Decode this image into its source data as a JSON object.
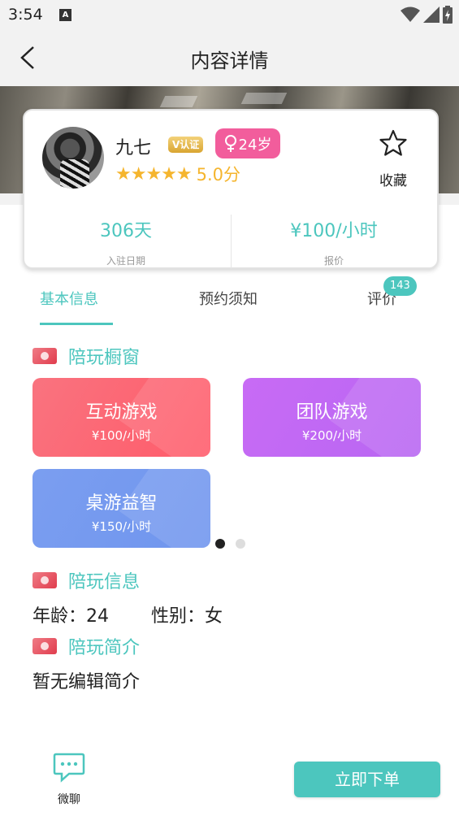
{
  "status_bar": {
    "time": "3:54",
    "notification_letter": "A"
  },
  "header": {
    "title": "内容详情"
  },
  "profile": {
    "nickname": "九七",
    "verified_label": "V认证",
    "age_label": "24岁",
    "stars": "★★★★★",
    "rating": "5.0分",
    "favorite_label": "收藏",
    "days_value": "306天",
    "days_label": "入驻日期",
    "price_value": "¥100/小时",
    "price_label": "报价"
  },
  "tabs": [
    {
      "label": "基本信息",
      "active": true
    },
    {
      "label": "预约须知",
      "active": false
    },
    {
      "label": "评价",
      "active": false,
      "badge": "143"
    }
  ],
  "sections": {
    "showcase_title": "陪玩橱窗",
    "info_title": "陪玩信息",
    "intro_title": "陪玩简介"
  },
  "services": [
    {
      "name": "互动游戏",
      "price": "¥100/小时"
    },
    {
      "name": "团队游戏",
      "price": "¥200/小时"
    },
    {
      "name": "桌游益智",
      "price": "¥150/小时"
    }
  ],
  "carousel": {
    "pages": 2,
    "current": 1
  },
  "info": {
    "age_text": "年龄：24",
    "gender_text": "性别：女"
  },
  "intro": {
    "text": "暂无编辑简介"
  },
  "bottom": {
    "chat_label": "微聊",
    "order_label": "立即下单"
  },
  "colors": {
    "accent": "#4cc6be",
    "pink": "#f25d9c",
    "star": "#f5b52e"
  },
  "icons": [
    "back-arrow-icon",
    "star-outline-icon",
    "female-icon",
    "chat-bubble-icon",
    "wifi-icon",
    "signal-icon",
    "battery-icon"
  ]
}
